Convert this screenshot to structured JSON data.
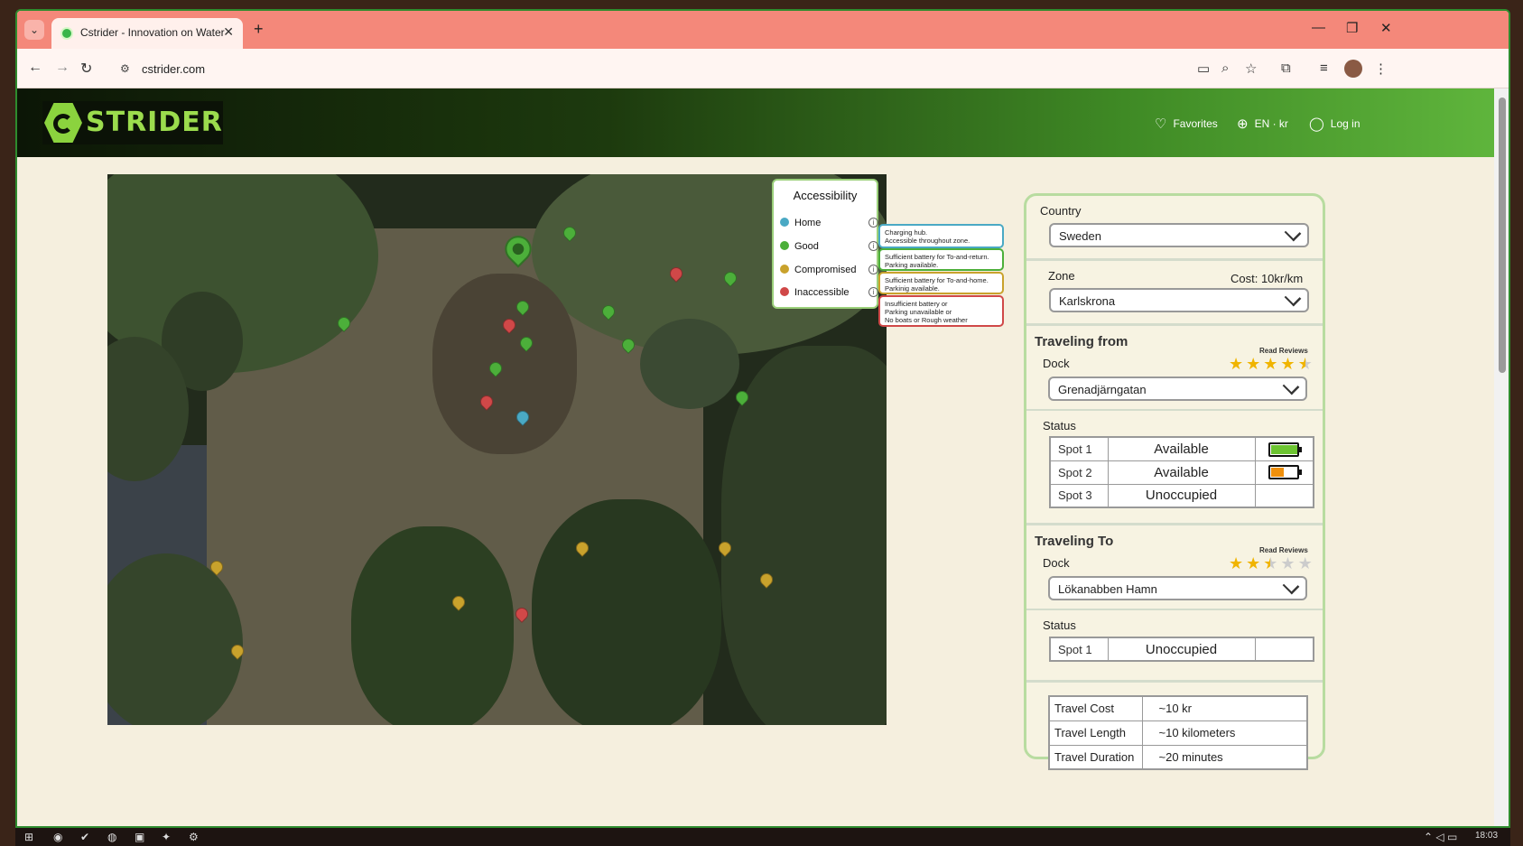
{
  "browser": {
    "tab_title": "Cstrider - Innovation on Water",
    "tab_close": "✕",
    "new_tab": "+",
    "url": "cstrider.com",
    "tab_search": "⌄",
    "win_minimize": "—",
    "win_restore": "❐",
    "win_close": "✕"
  },
  "site": {
    "logo_text": "STRIDER",
    "nav": {
      "favorites": "Favorites",
      "language": "EN · kr",
      "login": "Log in"
    }
  },
  "legend": {
    "title": "Accessibility",
    "items": [
      {
        "label": "Home",
        "color": "#4aa9c4",
        "tip_line1": "Charging hub.",
        "tip_line2": "Accessible throughout zone.",
        "tip_line3": ""
      },
      {
        "label": "Good",
        "color": "#4caf3a",
        "tip_line1": "Sufficient battery for To-and-return.",
        "tip_line2": "Parking available.",
        "tip_line3": ""
      },
      {
        "label": "Compromised",
        "color": "#c9a22c",
        "tip_line1": "Sufficient battery for To-and-home.",
        "tip_line2": "Parkinig available.",
        "tip_line3": ""
      },
      {
        "label": "Inaccessible",
        "color": "#d04848",
        "tip_line1": "Insufficient battery or",
        "tip_line2": "Parking unavailable or",
        "tip_line3": "No boats  or Rough weather"
      }
    ]
  },
  "panel": {
    "country_label": "Country",
    "country_value": "Sweden",
    "zone_label": "Zone",
    "zone_cost": "Cost: 10kr/km",
    "zone_value": "Karlskrona",
    "from": {
      "heading": "Traveling from",
      "dock_label": "Dock",
      "reviews_link": "Read Reviews",
      "rating": 4.5,
      "dock_value": "Grenadjärngatan",
      "status_label": "Status",
      "spots": [
        {
          "name": "Spot 1",
          "state": "Available",
          "battery": 0.9,
          "battery_color": "#6cc431"
        },
        {
          "name": "Spot 2",
          "state": "Available",
          "battery": 0.45,
          "battery_color": "#f0900c"
        },
        {
          "name": "Spot 3",
          "state": "Unoccupied",
          "battery": null
        }
      ]
    },
    "to": {
      "heading": "Traveling To",
      "dock_label": "Dock",
      "reviews_link": "Read Reviews",
      "rating": 2.5,
      "dock_value": "Lökanabben Hamn",
      "status_label": "Status",
      "spots": [
        {
          "name": "Spot 1",
          "state": "Unoccupied",
          "battery": null
        }
      ]
    },
    "travel": [
      {
        "key": "Travel Cost",
        "value": "~10 kr"
      },
      {
        "key": "Travel Length",
        "value": "~10 kilometers"
      },
      {
        "key": "Travel Duration",
        "value": "~20 minutes"
      }
    ]
  },
  "taskbar": {
    "clock": "18:03"
  }
}
